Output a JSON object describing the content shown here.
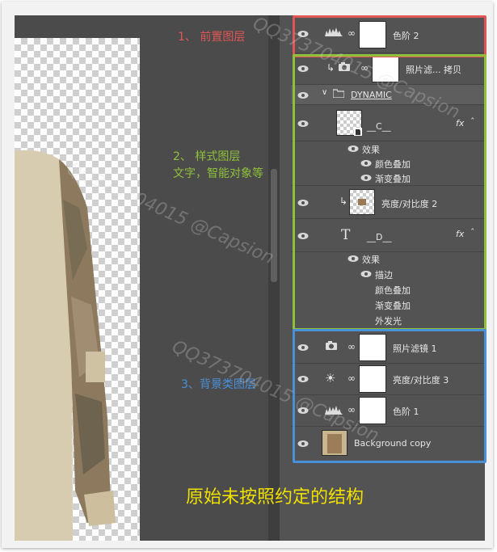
{
  "annotations": {
    "foreground": "1、 前置图层",
    "style_title": "2、 样式图层",
    "style_sub": "文字，智能对象等",
    "background": "3、背景类图层",
    "caption": "原始未按照约定的结构"
  },
  "watermark": "QQ373704015 @Capsion",
  "layers": {
    "levels2": "色阶 2",
    "photo_filter_copy": "照片滤... 拷贝",
    "group": "DYNAMIC",
    "layer_c": "__C__",
    "effects_c": "效果",
    "color_overlay_c": "颜色叠加",
    "gradient_overlay_c": "渐变叠加",
    "brightness2": "亮度/对比度 2",
    "layer_d": "__D__",
    "effects_d": "效果",
    "stroke_d": "描边",
    "color_overlay_d": "颜色叠加",
    "gradient_overlay_d": "渐变叠加",
    "outer_glow_d": "外发光",
    "photo_filter1": "照片滤镜 1",
    "brightness3": "亮度/对比度 3",
    "levels1": "色阶 1",
    "background_copy": "Background copy",
    "fx": "fx",
    "text_glyph": "T"
  },
  "colors": {
    "red": "#e05555",
    "green": "#8fc03a",
    "blue": "#4a90d9",
    "caption": "#f0e000"
  }
}
